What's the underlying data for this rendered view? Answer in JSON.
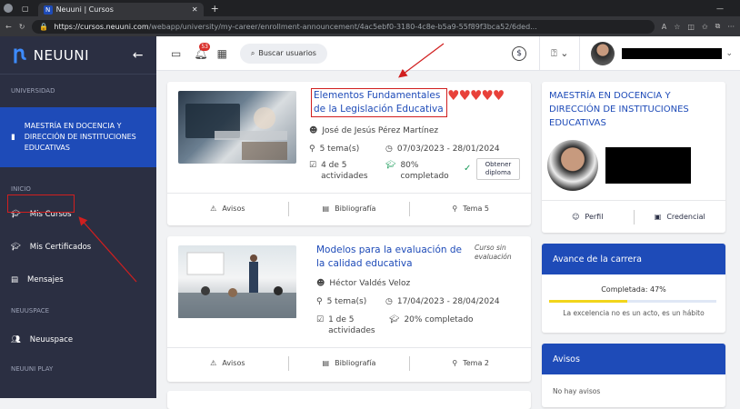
{
  "browser": {
    "tab_title": "Neuuni | Cursos",
    "url_host": "https://cursos.neuuni.com",
    "url_path": "/webapp/university/my-career/enrollment-announcement/4ac5ebf0-3180-4c8e-b5a9-55f89f3bca52/6ded..."
  },
  "sidebar": {
    "brand": "NEUUNI",
    "sections": {
      "universidad": "UNIVERSIDAD",
      "inicio": "INICIO",
      "neuuspace": "NEUUSPACE",
      "neuuniplay": "NEUUNI PLAY"
    },
    "program": "MAESTRÍA EN DOCENCIA Y DIRECCIÓN DE INSTITUCIONES EDUCATIVAS",
    "items": [
      {
        "label": "Mis Cursos"
      },
      {
        "label": "Mis Certificados"
      },
      {
        "label": "Mensajes"
      },
      {
        "label": "Neuuspace"
      }
    ]
  },
  "topbar": {
    "notif_count": "53",
    "search_label": "Buscar usuarios"
  },
  "courses": [
    {
      "title": "Elementos Fundamentales de la Legislación Educativa",
      "teacher": "José de Jesús Pérez Martínez",
      "topics": "5 tema(s)",
      "dates": "07/03/2023 - 28/01/2024",
      "activities": "4 de 5 actividades",
      "progress": "80% completado",
      "diploma": "Obtener diploma",
      "hearts": 5,
      "tabs": [
        "Avisos",
        "Bibliografía",
        "Tema 5"
      ]
    },
    {
      "title": "Modelos para la evaluación de la calidad educativa",
      "status": "Curso sin evaluación",
      "teacher": "Héctor Valdés Veloz",
      "topics": "5 tema(s)",
      "dates": "17/04/2023 - 28/04/2024",
      "activities": "1 de 5 actividades",
      "progress": "20% completado",
      "tabs": [
        "Avisos",
        "Bibliografía",
        "Tema 2"
      ]
    }
  ],
  "profile": {
    "program": "MAESTRÍA EN DOCENCIA Y DIRECCIÓN DE INSTITUCIONES EDUCATIVAS",
    "perfil": "Perfil",
    "credencial": "Credencial"
  },
  "career": {
    "title": "Avance de la carrera",
    "completed": "Completada: 47%",
    "progress": 0.47,
    "quote": "La excelencia no es un acto, es un hábito"
  },
  "notices": {
    "title": "Avisos",
    "empty": "No hay avisos"
  },
  "colors": {
    "primary": "#1e4bb8",
    "sidebar": "#2b2f42",
    "heart": "#e8413a",
    "annotation": "#d11f1f",
    "progress": "#f2d51b"
  }
}
